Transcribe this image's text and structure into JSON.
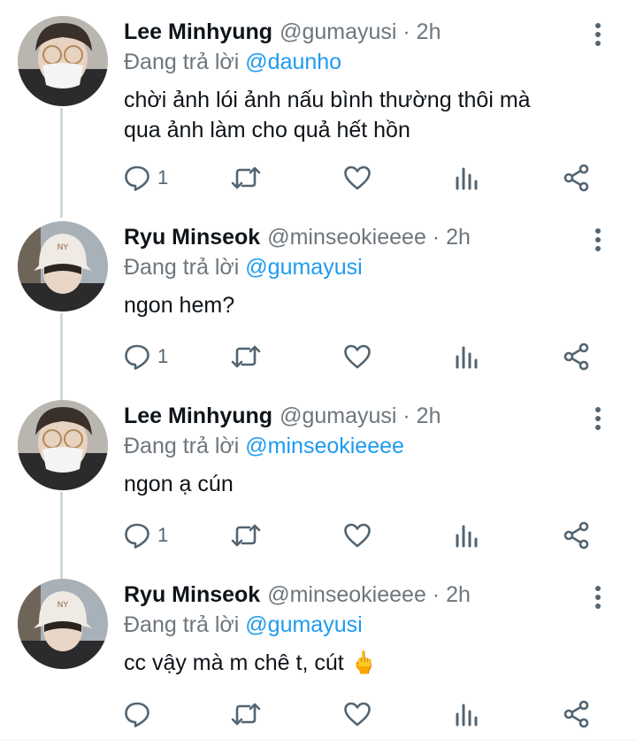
{
  "colors": {
    "name": "#0f1419",
    "secondary": "#6e767d",
    "mention": "#1d9bf0",
    "icon": "#536471",
    "thread_line": "#cfd9de"
  },
  "icons": {
    "more": "more-vertical-icon",
    "reply": "reply-bubble-icon",
    "retweet": "retweet-icon",
    "like": "heart-icon",
    "stats": "bar-chart-icon",
    "share": "share-icon"
  },
  "tweets": [
    {
      "name": "Lee Minhyung",
      "handle": "@gumayusi",
      "time": "· 2h",
      "reply_prefix": "Đang trả lời ",
      "reply_to": "@daunho",
      "text_lines": [
        "chời ảnh lói ảnh nấu bình thường thôi mà",
        "qua ảnh làm cho quả hết hồn"
      ],
      "reply_count": "1"
    },
    {
      "name": "Ryu Minseok",
      "handle": "@minseokieeee",
      "time": "· 2h",
      "reply_prefix": "Đang trả lời ",
      "reply_to": "@gumayusi",
      "text_lines": [
        "ngon hem?"
      ],
      "reply_count": "1"
    },
    {
      "name": "Lee Minhyung",
      "handle": "@gumayusi",
      "time": "· 2h",
      "reply_prefix": "Đang trả lời ",
      "reply_to": "@minseokieeee",
      "text_lines": [
        "ngon ạ cún"
      ],
      "reply_count": "1"
    },
    {
      "name": "Ryu Minseok",
      "handle": "@minseokieeee",
      "time": "· 2h",
      "reply_prefix": "Đang trả lời ",
      "reply_to": "@gumayusi",
      "text_lines": [
        "cc vậy mà m chê t, cút 🖕"
      ],
      "reply_count": ""
    }
  ]
}
